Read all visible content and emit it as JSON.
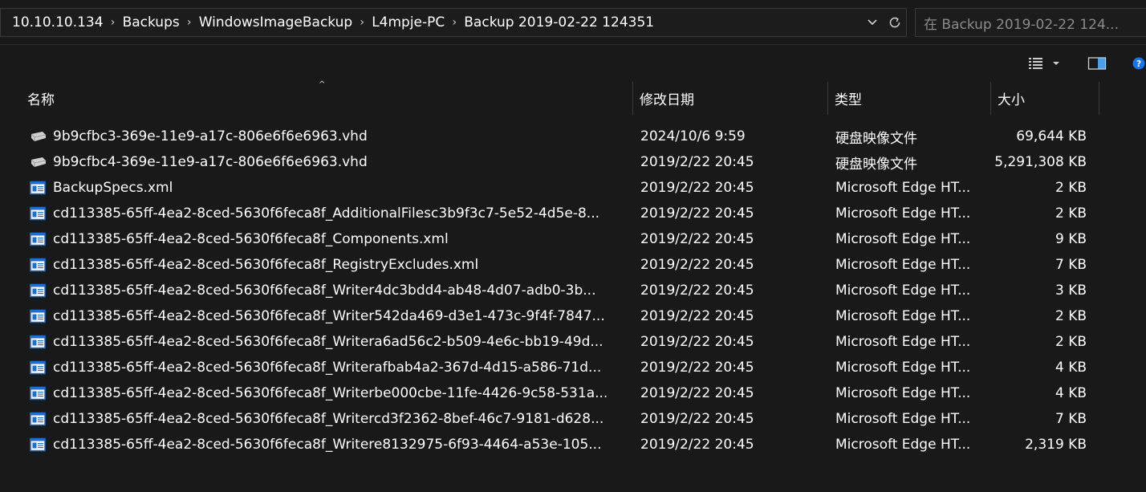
{
  "address": {
    "crumbs": [
      "10.10.10.134",
      "Backups",
      "WindowsImageBackup",
      "L4mpje-PC",
      "Backup 2019-02-22 124351"
    ],
    "dropdown_icon": "chevron-down-icon",
    "refresh_icon": "refresh-icon"
  },
  "search": {
    "placeholder": "在 Backup 2019-02-22 124..."
  },
  "toolbar": {
    "view_icon": "details-view-icon",
    "preview_icon": "preview-pane-icon",
    "help_icon": "help-icon"
  },
  "columns": {
    "name": "名称",
    "date": "修改日期",
    "type": "类型",
    "size": "大小"
  },
  "files": [
    {
      "name": "9b9cfbc3-369e-11e9-a17c-806e6f6e6963.vhd",
      "date": "2024/10/6 9:59",
      "type": "硬盘映像文件",
      "size": "69,644 KB",
      "icon": "vhd"
    },
    {
      "name": "9b9cfbc4-369e-11e9-a17c-806e6f6e6963.vhd",
      "date": "2019/2/22 20:45",
      "type": "硬盘映像文件",
      "size": "5,291,308 KB",
      "icon": "vhd"
    },
    {
      "name": "BackupSpecs.xml",
      "date": "2019/2/22 20:45",
      "type": "Microsoft Edge HT...",
      "size": "2 KB",
      "icon": "xml"
    },
    {
      "name": "cd113385-65ff-4ea2-8ced-5630f6feca8f_AdditionalFilesc3b9f3c7-5e52-4d5e-8...",
      "date": "2019/2/22 20:45",
      "type": "Microsoft Edge HT...",
      "size": "2 KB",
      "icon": "xml"
    },
    {
      "name": "cd113385-65ff-4ea2-8ced-5630f6feca8f_Components.xml",
      "date": "2019/2/22 20:45",
      "type": "Microsoft Edge HT...",
      "size": "9 KB",
      "icon": "xml"
    },
    {
      "name": "cd113385-65ff-4ea2-8ced-5630f6feca8f_RegistryExcludes.xml",
      "date": "2019/2/22 20:45",
      "type": "Microsoft Edge HT...",
      "size": "7 KB",
      "icon": "xml"
    },
    {
      "name": "cd113385-65ff-4ea2-8ced-5630f6feca8f_Writer4dc3bdd4-ab48-4d07-adb0-3b...",
      "date": "2019/2/22 20:45",
      "type": "Microsoft Edge HT...",
      "size": "3 KB",
      "icon": "xml"
    },
    {
      "name": "cd113385-65ff-4ea2-8ced-5630f6feca8f_Writer542da469-d3e1-473c-9f4f-7847...",
      "date": "2019/2/22 20:45",
      "type": "Microsoft Edge HT...",
      "size": "2 KB",
      "icon": "xml"
    },
    {
      "name": "cd113385-65ff-4ea2-8ced-5630f6feca8f_Writera6ad56c2-b509-4e6c-bb19-49d...",
      "date": "2019/2/22 20:45",
      "type": "Microsoft Edge HT...",
      "size": "2 KB",
      "icon": "xml"
    },
    {
      "name": "cd113385-65ff-4ea2-8ced-5630f6feca8f_Writerafbab4a2-367d-4d15-a586-71d...",
      "date": "2019/2/22 20:45",
      "type": "Microsoft Edge HT...",
      "size": "4 KB",
      "icon": "xml"
    },
    {
      "name": "cd113385-65ff-4ea2-8ced-5630f6feca8f_Writerbe000cbe-11fe-4426-9c58-531a...",
      "date": "2019/2/22 20:45",
      "type": "Microsoft Edge HT...",
      "size": "4 KB",
      "icon": "xml"
    },
    {
      "name": "cd113385-65ff-4ea2-8ced-5630f6feca8f_Writercd3f2362-8bef-46c7-9181-d628...",
      "date": "2019/2/22 20:45",
      "type": "Microsoft Edge HT...",
      "size": "7 KB",
      "icon": "xml"
    },
    {
      "name": "cd113385-65ff-4ea2-8ced-5630f6feca8f_Writere8132975-6f93-4464-a53e-105...",
      "date": "2019/2/22 20:45",
      "type": "Microsoft Edge HT...",
      "size": "2,319 KB",
      "icon": "xml"
    }
  ],
  "colors": {
    "background": "#191919",
    "text": "#ffffff",
    "help_blue": "#1a73e8"
  }
}
